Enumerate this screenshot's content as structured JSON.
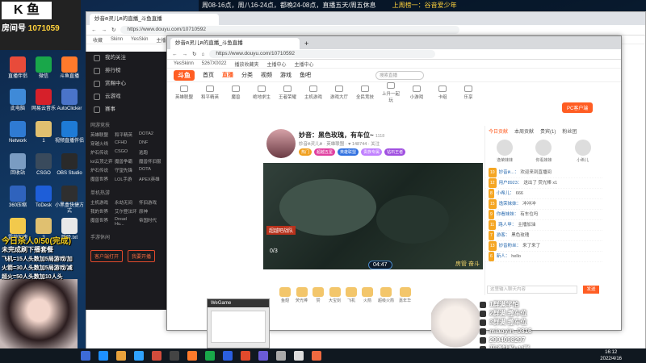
{
  "overlay_top": {
    "schedule": "周08-16点，周八16-24点，都晚24-08点，直播五天/周五休息",
    "em": "上周榜一：谷音爱少年"
  },
  "streamer_badge": {
    "logo": "K 鱼",
    "room": "房间号",
    "room_no": "1071059"
  },
  "desktop_icons": [
    {
      "label": "直播伴侣",
      "color": "#e84b3a"
    },
    {
      "label": "微信",
      "color": "#19a74a"
    },
    {
      "label": "斗鱼直播",
      "color": "#ff7a2b"
    },
    {
      "label": "此电脑",
      "color": "#3f8ad8"
    },
    {
      "label": "网易云音乐",
      "color": "#d6202a"
    },
    {
      "label": "AutoClicker",
      "color": "#4a74c9"
    },
    {
      "label": "Network",
      "color": "#2f7bd3"
    },
    {
      "label": "1",
      "color": "#e0c070"
    },
    {
      "label": "视频直播伴侣",
      "color": "#1e7bd6"
    },
    {
      "label": "回收站",
      "color": "#7a9cc2"
    },
    {
      "label": "CSGO",
      "color": "#394a5c"
    },
    {
      "label": "OBS Studio",
      "color": "#2a2a2a"
    },
    {
      "label": "360压缩",
      "color": "#2f63bd"
    },
    {
      "label": "ToDesk",
      "color": "#1e5ed8"
    },
    {
      "label": "小黑盒快捷方式",
      "color": "#2f2f2f"
    },
    {
      "label": "雷神加速",
      "color": "#f2c94c"
    },
    {
      "label": "3",
      "color": "#e0c070"
    },
    {
      "label": "呼吸.txt",
      "color": "#e8e8e8"
    }
  ],
  "back_browser": {
    "tab": "妙音ฅ灵儿ฅ的直播_斗鱼直播",
    "url": "https://www.douyu.com/10710592",
    "bookmarks": [
      "收藏",
      "Skinn",
      "YesSkin",
      "主播中心",
      "主播中心"
    ]
  },
  "left_nav": {
    "items": [
      "我的关注",
      "排行榜",
      "赏赐中心",
      "云游戏",
      "赛事"
    ],
    "sections": [
      {
        "title": "网游竞技",
        "games": [
          "英雄联盟",
          "和平精英",
          "DOTA2",
          "穿越火线",
          "CFHD",
          "DNF",
          "炉石传说",
          "CSGO",
          "逃跑",
          "lol云顶之弈",
          "魔兽争霸",
          "魔兽怀旧服",
          "炉石传说",
          "守望先锋",
          "DOTA",
          "魔兽世界",
          "LOL手游",
          "APEX英雄"
        ]
      },
      {
        "title": "单机热游",
        "games": [
          "主机游戏",
          "永劫无间",
          "怀旧游戏",
          "我的世界",
          "艾尔登法环",
          "原神",
          "魔兽世界",
          "Dread Hu...",
          "帝国时代"
        ]
      },
      {
        "title": "手游休闲",
        "games": []
      }
    ],
    "buttons": [
      "客户端打开",
      "我要开播"
    ]
  },
  "front_browser": {
    "tab": "妙音ฅ灵儿ฅ的直播_斗鱼直播",
    "url": "https://www.douyu.com/10710592",
    "bookmarks": [
      "YesSkinn",
      "5267X0022",
      "播放收藏夹",
      "主播中心",
      "主播中心"
    ],
    "nav": {
      "brand": "斗鱼",
      "items": [
        "首页",
        "直播",
        "分类",
        "视频",
        "游戏",
        "鱼吧"
      ],
      "active": 1,
      "search_placeholder": "搜索直播"
    },
    "categories": [
      "英雄联盟",
      "和平精英",
      "魔兽",
      "绝地求生",
      "王者荣耀",
      "主机游戏",
      "游戏大厅",
      "全民竞技",
      "上升一起玩",
      "小游戏",
      "卡组",
      "乐享"
    ],
    "pc_button": "PC客户端",
    "room": {
      "title": "妙音：黑色玫瑰，有车位~",
      "level": "1118",
      "meta": "妙音ฅ灵儿ฅ  ·  英雄联盟  ·  ♥ 148744  ·  关注",
      "tags": [
        {
          "t": "热门",
          "c": "#f0a020"
        },
        {
          "t": "超越五星",
          "c": "#e040a0"
        },
        {
          "t": "英雄联盟",
          "c": "#3070e0"
        },
        {
          "t": "贵族专属",
          "c": "#c080ff"
        },
        {
          "t": "钻石王者",
          "c": "#a050e0"
        }
      ]
    },
    "video": {
      "timer": "04:47",
      "score": "0/3",
      "caption": "超越吧战队",
      "watermark": "房管 奋斗"
    },
    "gift_bar": [
      "鱼翅",
      "荧光棒",
      "赞",
      "大宝剑",
      "飞机",
      "火箭",
      "超级火箭",
      "嘉年华"
    ],
    "chat": {
      "tabs": [
        "今日贡献",
        "本周贡献",
        "贵宾(1)",
        "粉丝团"
      ],
      "rank": [
        "逸荣妹妹",
        "你看妹妹",
        "小希儿"
      ],
      "messages": [
        {
          "lv": "10",
          "name": "妙音ฅ...",
          "text": "欢迎来到直播间"
        },
        {
          "lv": "12",
          "name": "用户8923",
          "text": "送出了 荧光棒 x1"
        },
        {
          "lv": "8",
          "name": "小希儿",
          "text": "666"
        },
        {
          "lv": "15",
          "name": "逸荣妹妹",
          "text": "冲冲冲"
        },
        {
          "lv": "9",
          "name": "你看妹妹",
          "text": "有车位吗"
        },
        {
          "lv": "11",
          "name": "路人甲",
          "text": "主播加油"
        },
        {
          "lv": "7",
          "name": "游客",
          "text": "黑色玫瑰"
        },
        {
          "lv": "13",
          "name": "妙音粉丝",
          "text": "来了来了"
        },
        {
          "lv": "6",
          "name": "新人",
          "text": "hello"
        }
      ],
      "input_placeholder": "这里输入聊天内容",
      "send": "发送"
    }
  },
  "overlay_left": [
    {
      "text": "今日杀人0/50(完成)",
      "color": "#f5d020",
      "size": 10
    },
    {
      "text": "未完成刷下播套餐",
      "color": "#ffffff",
      "size": 8
    },
    {
      "text": "飞机=15人头数加5局游戏/加",
      "color": "#ffffff",
      "size": 7
    },
    {
      "text": "火箭=30人头数加5局游戏/减",
      "color": "#ffffff",
      "size": 7
    },
    {
      "text": "超火=50人头数加10人头",
      "color": "#ffffff",
      "size": 7
    }
  ],
  "qq_overlay": [
    {
      "text": "1群满学怕"
    },
    {
      "text": "2群满 撒车位"
    },
    {
      "text": "3群满 撒车位"
    },
    {
      "text": "miaoyin_0816"
    },
    {
      "text": "2994098297"
    },
    {
      "text": "开通钻粉+V群"
    }
  ],
  "wegame": {
    "title": "WeGame"
  },
  "clock": {
    "time": "16:12",
    "date": "2022/4/16"
  }
}
